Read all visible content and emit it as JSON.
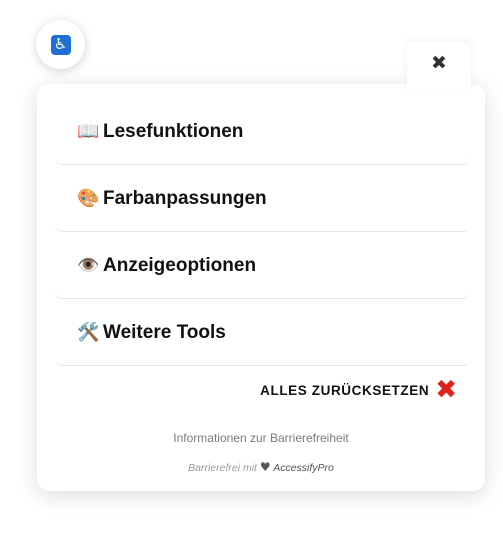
{
  "widget": {
    "toggle_icon": "wheelchair-icon",
    "toggle_glyph": "♿",
    "close_glyph": "✖",
    "accent_color": "#1f6fd6"
  },
  "sections": [
    {
      "emoji": "📖",
      "label": "Lesefunktionen",
      "icon": "book-icon"
    },
    {
      "emoji": "🎨",
      "label": "Farbanpassungen",
      "icon": "palette-icon"
    },
    {
      "emoji": "👁️",
      "label": "Anzeigeoptionen",
      "icon": "eye-icon"
    },
    {
      "emoji": "🛠️",
      "label": "Weitere Tools",
      "icon": "tools-icon"
    }
  ],
  "reset": {
    "label": "ALLES ZURÜCKSETZEN",
    "glyph": "✖",
    "color": "#e0201b"
  },
  "footer": {
    "info_link": "Informationen zur Barrierefreiheit",
    "credit_prefix": "Barrierefrei mit",
    "heart": "♥",
    "brand": "AccessifyPro"
  }
}
